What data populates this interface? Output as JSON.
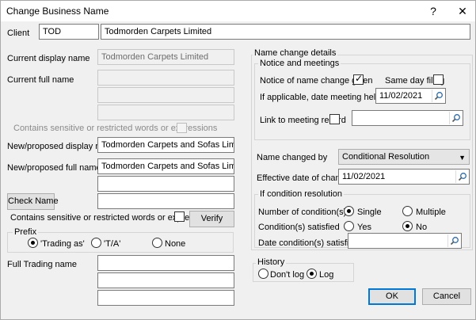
{
  "window": {
    "title": "Change Business Name",
    "help_glyph": "?",
    "close_glyph": "✕"
  },
  "client": {
    "label": "Client",
    "code": "TOD",
    "name": "Todmorden Carpets Limited"
  },
  "left": {
    "current_display_label": "Current display name",
    "current_display_value": "Todmorden Carpets Limited",
    "current_full_label": "Current full name",
    "current_full_lines": [
      "",
      "",
      ""
    ],
    "sensitive_label_1": "Contains sensitive or restricted words or expressions",
    "new_display_label": "New/proposed display name",
    "new_display_value": "Todmorden Carpets and Sofas Limited",
    "new_full_label": "New/proposed full name",
    "new_full_lines": [
      "Todmorden Carpets and Sofas Limited",
      "",
      ""
    ],
    "check_name_button": "Check Name",
    "sensitive_label_2": "Contains sensitive or restricted words or expressions",
    "verify_button": "Verify",
    "prefix": {
      "title": "Prefix",
      "options": [
        "'Trading as'",
        "'T/A'",
        "None"
      ],
      "selected": 0
    },
    "full_trading_label": "Full Trading name",
    "full_trading_lines": [
      "",
      "",
      ""
    ]
  },
  "right": {
    "group_title": "Name change details",
    "notice_group_title": "Notice and meetings",
    "notice_label": "Notice of name change given",
    "notice_checked": true,
    "same_day_label": "Same day filing",
    "same_day_checked": false,
    "meeting_date_label": "If applicable, date meeting held",
    "meeting_date_value": "11/02/2021",
    "link_meeting_label": "Link to meeting record",
    "link_meeting_checked": false,
    "link_meeting_value": "",
    "name_changed_by_label": "Name changed by",
    "name_changed_by_value": "Conditional Resolution",
    "effective_date_label": "Effective date of change",
    "effective_date_value": "11/02/2021",
    "condition_group_title": "If condition resolution",
    "num_conditions_label": "Number of condition(s)",
    "num_conditions_options": [
      "Single",
      "Multiple"
    ],
    "num_conditions_selected": 0,
    "conditions_satisfied_label": "Condition(s) satisfied",
    "conditions_satisfied_options": [
      "Yes",
      "No"
    ],
    "conditions_satisfied_selected": 1,
    "date_satisfied_label": "Date condition(s) satisfied",
    "date_satisfied_value": ""
  },
  "history": {
    "title": "History",
    "options": [
      "Don't log",
      "Log"
    ],
    "selected": 1
  },
  "buttons": {
    "ok": "OK",
    "cancel": "Cancel"
  },
  "colors": {
    "accent": "#0078d7",
    "background": "#f0f0f0"
  }
}
